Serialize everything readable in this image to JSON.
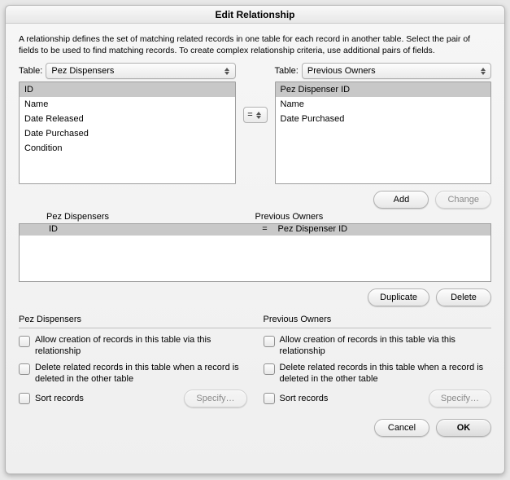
{
  "title": "Edit Relationship",
  "description": "A relationship defines the set of matching related records in one table for each record in another table. Select the pair of fields to be used to find matching records. To create complex relationship criteria, use additional pairs of fields.",
  "leftTable": {
    "label": "Table:",
    "selected": "Pez Dispensers",
    "fields": [
      "ID",
      "Name",
      "Date Released",
      "Date Purchased",
      "Condition"
    ],
    "selectedField": "ID"
  },
  "rightTable": {
    "label": "Table:",
    "selected": "Previous Owners",
    "fields": [
      "Pez Dispenser ID",
      "Name",
      "Date Purchased"
    ],
    "selectedField": "Pez Dispenser ID"
  },
  "operator": "=",
  "buttons": {
    "add": "Add",
    "change": "Change",
    "duplicate": "Duplicate",
    "delete": "Delete",
    "cancel": "Cancel",
    "ok": "OK",
    "specify": "Specify…"
  },
  "pair": {
    "leftHeader": "Pez Dispensers",
    "rightHeader": "Previous Owners",
    "rows": [
      {
        "left": "ID",
        "op": "=",
        "right": "Pez Dispenser ID"
      }
    ]
  },
  "options": {
    "leftHeading": "Pez Dispensers",
    "rightHeading": "Previous Owners",
    "allowCreate": "Allow creation of records in this table via this relationship",
    "deleteRelated": "Delete related records in this table when a record is deleted in the other table",
    "sortRecords": "Sort records"
  }
}
